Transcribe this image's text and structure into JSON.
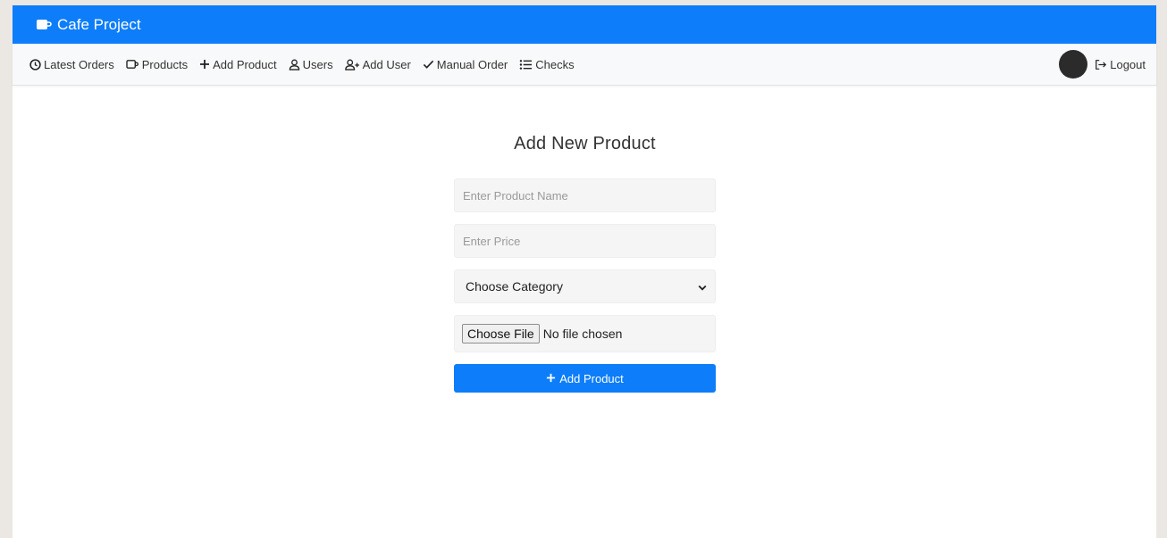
{
  "brand": {
    "title": "Cafe Project",
    "icon": "cup-icon",
    "bar_color": "#0d7dfa"
  },
  "nav": {
    "items": [
      {
        "label": "Latest Orders",
        "icon": "clock-icon"
      },
      {
        "label": "Products",
        "icon": "cup-icon"
      },
      {
        "label": "Add Product",
        "icon": "plus-icon"
      },
      {
        "label": "Users",
        "icon": "user-icon"
      },
      {
        "label": "Add User",
        "icon": "user-plus-icon"
      },
      {
        "label": "Manual Order",
        "icon": "check-icon"
      },
      {
        "label": "Checks",
        "icon": "list-icon"
      }
    ],
    "logout_label": "Logout"
  },
  "form": {
    "title": "Add New Product",
    "name_placeholder": "Enter Product Name",
    "price_placeholder": "Enter Price",
    "category_selected": "Choose Category",
    "file_button": "Choose File",
    "file_status": "No file chosen",
    "submit_label": "Add Product"
  }
}
